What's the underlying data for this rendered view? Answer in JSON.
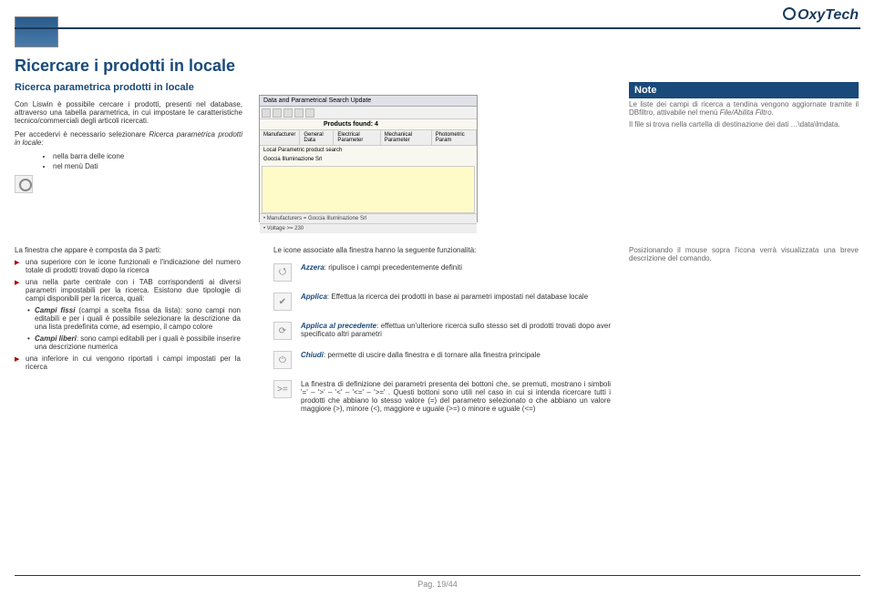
{
  "brand": "OxyTech",
  "page_title": "Ricercare i prodotti in locale",
  "subtitle": "Ricerca parametrica prodotti in locale",
  "note_badge": "Note",
  "col_left": {
    "p1_a": "Con Liswin è possibile cercare i prodotti, presenti nel database, attraverso una tabella parametrica, in cui impostare le caratteristiche tecnico/commerciali degli articoli ricercati.",
    "p2_a": "Per accedervi è necessario selezionare ",
    "p2_em": "Ricerca parametrica prodotti in locale:",
    "li1": "nella barra delle icone",
    "li2": "nel menù Dati"
  },
  "screenshot": {
    "title": "Data and Parametrical Search Update",
    "found": "Products found: 4",
    "tabs": [
      "Manufacturer",
      "General Data",
      "Electrical Parameter",
      "Mechanical Parameter",
      "Photometric Param"
    ],
    "section": "Local Parametric product search",
    "row1_label": "Goccia Illuminazione Srl",
    "status1": "• Manufacturers = Goccia Illuminazione Srl",
    "status2": "• Voltage >= 230"
  },
  "note": {
    "p1": "Le liste dei campi di ricerca a tendina vengono aggiornate tramite il DBfiltro, attivabile nel menù ",
    "p1_em": "File/Abilita Filtro.",
    "p2": "Il file si trova nella cartella di destinazione dei dati …\\data\\lmdata."
  },
  "lower_left": {
    "intro": "La finestra che appare è composta da 3 parti:",
    "a1": "una superiore con le icone funzionali e l'indicazione del numero totale di prodotti trovati dopo la ricerca",
    "a2": "una nella parte centrale con i TAB corrispondenti ai diversi parametri impostabili per la ricerca. Esistono due tipologie di campi disponibili per la ricerca, quali:",
    "b1_head": "Campi fissi",
    "b1_tail": " (campi a scelta fissa da lista): sono campi non editabili e per i quali è possibile selezionare la descrizione da una lista predefinita come, ad esempio, il campo colore",
    "b2_head": "Campi liberi",
    "b2_tail": ": sono campi editabili per i quali è possibile inserire una descrizione numerica",
    "a3": "una inferiore in cui vengono riportati i campi impostati per la ricerca"
  },
  "lower_mid": {
    "lead": "Le icone associate alla finestra hanno la seguente funzionalità:",
    "r1_key": "Azzera",
    "r1_txt": ": ripulisce i campi precedentemente definiti",
    "r2_key": "Applica",
    "r2_txt": ": Effettua la ricerca dei prodotti in base ai parametri impostati nel database locale",
    "r3_key": "Applica al precedente",
    "r3_txt": ": effettua un'ulteriore ricerca sullo stesso set di prodotti trovati dopo aver specificato altri parametri",
    "r4_key": "Chiudi",
    "r4_txt": ": permette di uscire dalla finestra e di tornare alla finestra principale",
    "r5_txt": "La finestra di definizione dei parametri presenta dei bottoni che, se premuti, mostrano i simboli '=' – '>' – '<' – '<=' – '>=' . Questi bottoni sono utili nel caso in cui si intenda ricercare tutti i prodotti che abbiano lo stesso valore (=) del parametro selezionato o che abbiano un valore maggiore (>), minore (<), maggiore e uguale (>=) o minore e uguale (<=)"
  },
  "lower_right": {
    "p1": "Posizionando il mouse sopra l'icona verrà visualizzata una breve descrizione del comando."
  },
  "footer": "Pag. 19/44"
}
